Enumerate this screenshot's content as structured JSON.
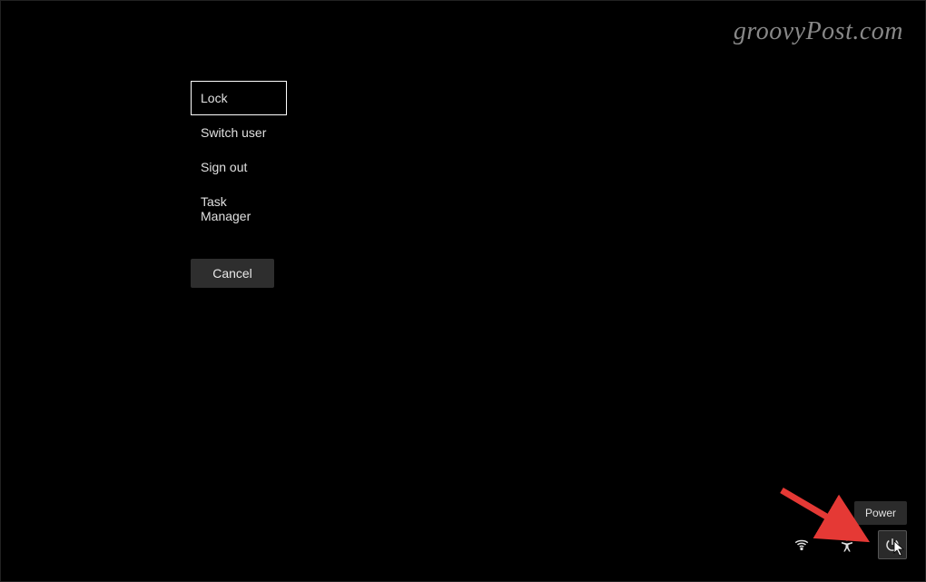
{
  "watermark": "groovyPost.com",
  "menu": {
    "items": [
      {
        "label": "Lock",
        "selected": true
      },
      {
        "label": "Switch user",
        "selected": false
      },
      {
        "label": "Sign out",
        "selected": false
      },
      {
        "label": "Task Manager",
        "selected": false
      }
    ],
    "cancel_label": "Cancel"
  },
  "tooltip": {
    "power_label": "Power"
  },
  "icons": {
    "wifi": "wifi-icon",
    "accessibility": "accessibility-icon",
    "power": "power-icon"
  }
}
